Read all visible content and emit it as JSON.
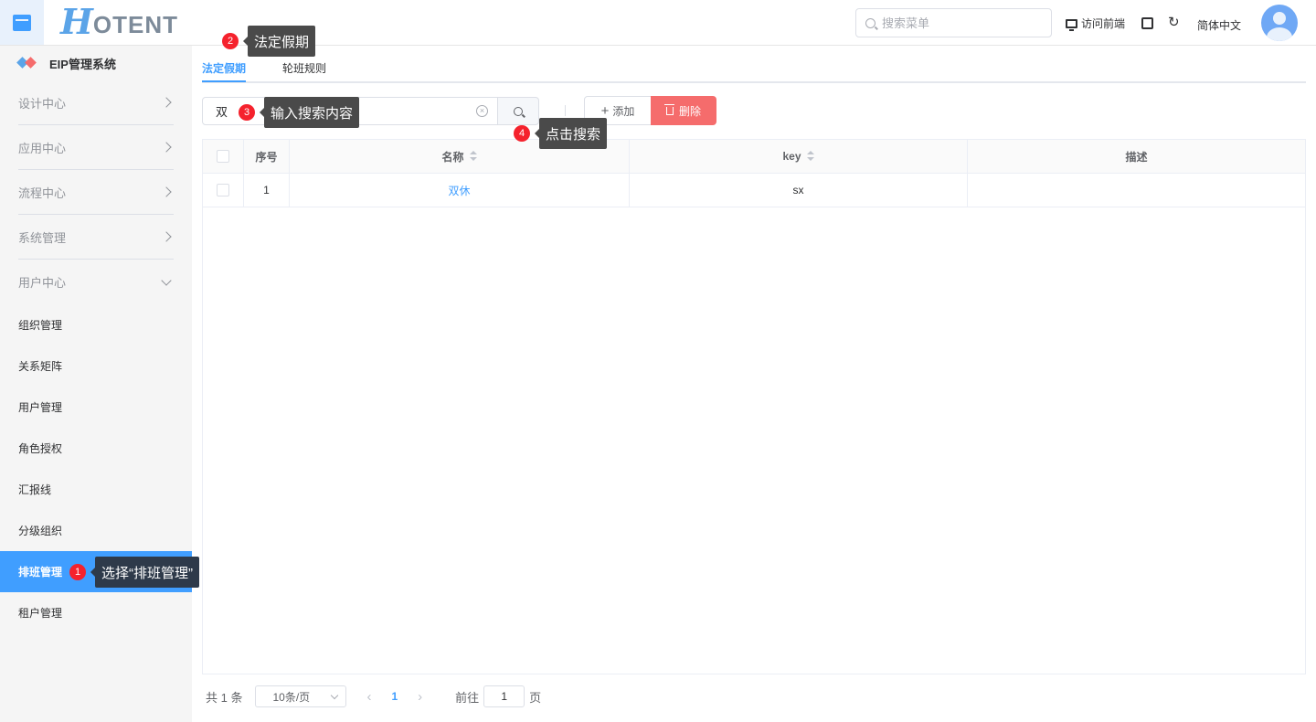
{
  "header": {
    "logo_h": "H",
    "logo_rest": "OTENT",
    "search_placeholder": "搜索菜单",
    "visit_label": "访问前端",
    "lang_label": "简体中文"
  },
  "sidebar": {
    "system_title": "EIP管理系统",
    "groups": [
      {
        "label": "设计中心"
      },
      {
        "label": "应用中心"
      },
      {
        "label": "流程中心"
      },
      {
        "label": "系统管理"
      },
      {
        "label": "用户中心"
      }
    ],
    "items": [
      {
        "label": "组织管理"
      },
      {
        "label": "关系矩阵"
      },
      {
        "label": "用户管理"
      },
      {
        "label": "角色授权"
      },
      {
        "label": "汇报线"
      },
      {
        "label": "分级组织"
      },
      {
        "label": "排班管理"
      },
      {
        "label": "租户管理"
      }
    ]
  },
  "tabs": [
    {
      "label": "法定假期"
    },
    {
      "label": "轮班规则"
    }
  ],
  "toolbar": {
    "query_value": "双",
    "add_label": "添加",
    "delete_label": "删除"
  },
  "table": {
    "columns": [
      "序号",
      "名称",
      "key",
      "描述"
    ],
    "rows": [
      {
        "index": "1",
        "name": "双休",
        "key": "sx",
        "desc": ""
      }
    ]
  },
  "pagination": {
    "total": "共 1 条",
    "page_size": "10条/页",
    "current": "1",
    "goto_prefix": "前往",
    "goto_value": "1",
    "goto_suffix": "页"
  },
  "annotations": [
    {
      "num": "1",
      "text": "选择“排班管理”"
    },
    {
      "num": "2",
      "text": "法定假期"
    },
    {
      "num": "3",
      "text": "输入搜索内容"
    },
    {
      "num": "4",
      "text": "点击搜索"
    }
  ],
  "colors": {
    "primary": "#409eff",
    "danger": "#f56c6c",
    "badge": "#f5222d"
  }
}
